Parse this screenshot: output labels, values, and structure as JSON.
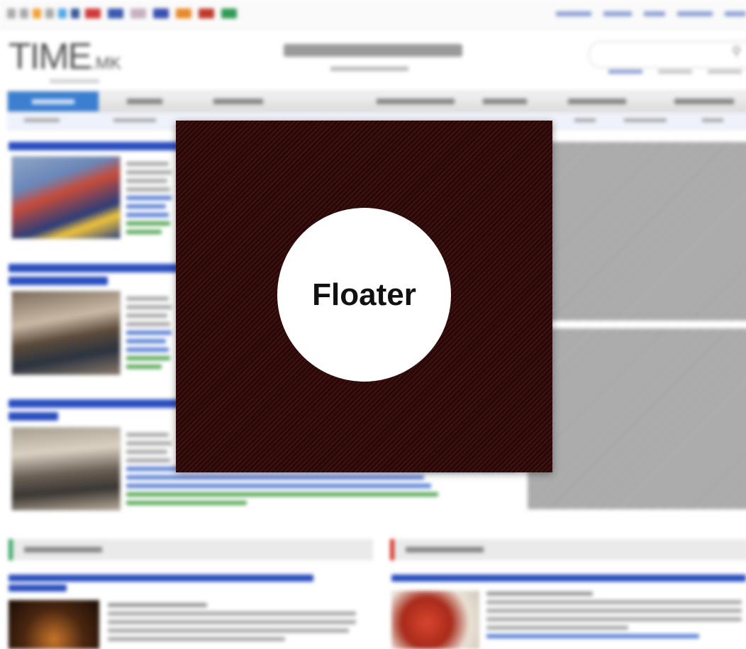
{
  "floater": {
    "label": "Floater"
  }
}
